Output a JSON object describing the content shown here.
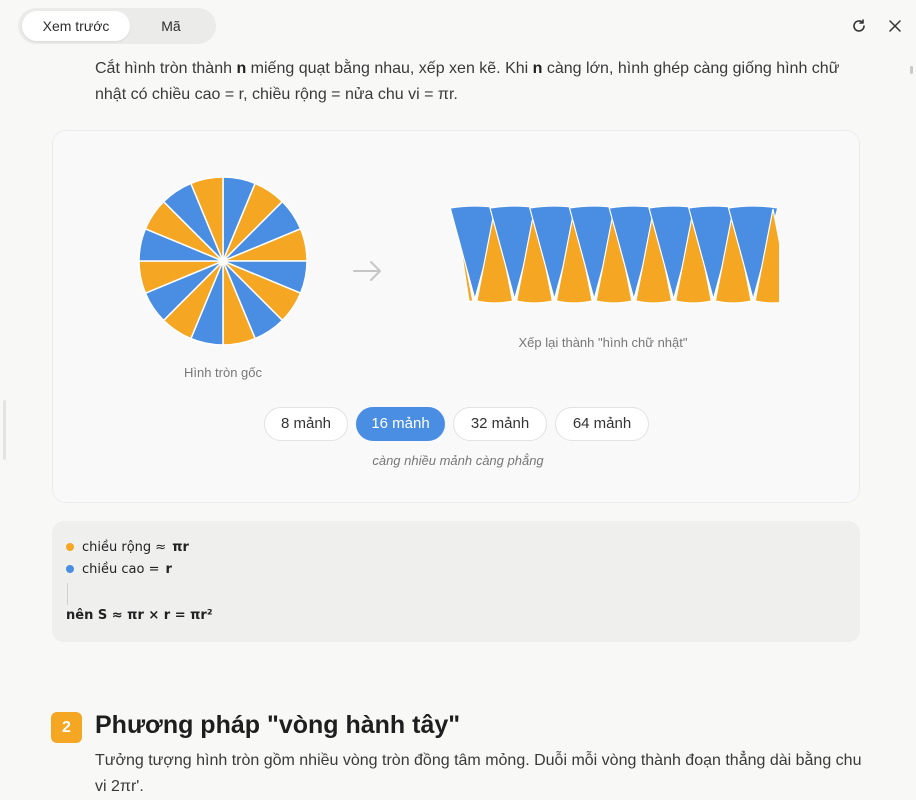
{
  "header": {
    "tabs": [
      "Xem trước",
      "Mã"
    ],
    "active_tab": "Xem trước"
  },
  "intro": {
    "part1": "Cắt hình tròn thành ",
    "n1": "n",
    "part2": " miếng quạt bằng nhau, xếp xen kẽ. Khi ",
    "n2": "n",
    "part3": " càng lớn, hình ghép càng giống hình chữ nhật có chiều cao = r, chiều rộng = nửa chu vi = πr."
  },
  "demo": {
    "pie_caption": "Hình tròn gốc",
    "rect_caption": "Xếp lại thành \"hình chữ nhật\"",
    "slices": 16,
    "options": [
      "8 mảnh",
      "16 mảnh",
      "32 mảnh",
      "64 mảnh"
    ],
    "active_option": "16 mảnh",
    "hint": "càng nhiều mảnh càng phẳng",
    "colors": {
      "orange": "#f5a623",
      "blue": "#4a8ee4"
    }
  },
  "formula": {
    "width_label": "chiều rộng ≈",
    "width_value": "πr",
    "height_label": "chiều cao =",
    "height_value": "r",
    "conclusion": "nên S ≈ πr × r = πr²"
  },
  "section2": {
    "number": "2",
    "title": "Phương pháp \"vòng hành tây\"",
    "body": "Tưởng tượng hình tròn gồm nhiều vòng tròn đồng tâm mỏng. Duỗi mỗi vòng thành đoạn thẳng dài bằng chu vi 2πr'."
  }
}
